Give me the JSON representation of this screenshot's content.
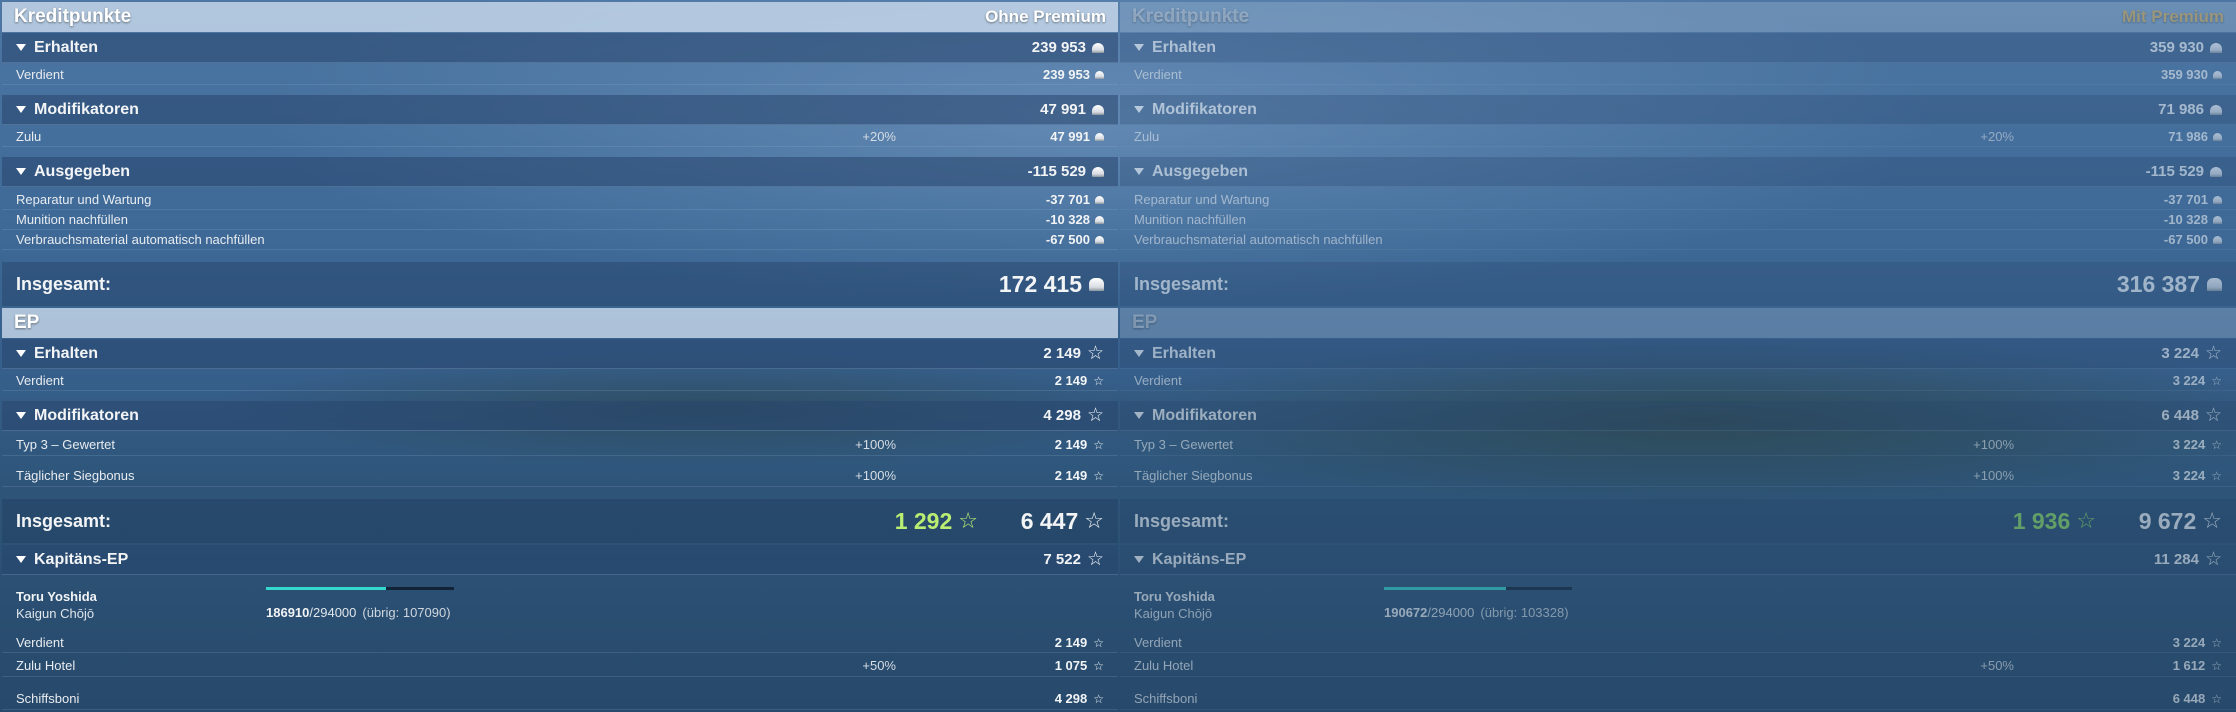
{
  "columns": [
    {
      "id": "standard",
      "title": "Kreditpunkte",
      "premium_label": "Ohne Premium",
      "credits": {
        "received": {
          "label": "Erhalten",
          "value": "239 953",
          "items": [
            {
              "label": "Verdient",
              "value": "239 953"
            }
          ]
        },
        "modifiers": {
          "label": "Modifikatoren",
          "value": "47 991",
          "items": [
            {
              "label": "Zulu",
              "mod": "+20%",
              "value": "47 991"
            }
          ]
        },
        "spent": {
          "label": "Ausgegeben",
          "value": "-115 529",
          "items": [
            {
              "label": "Reparatur und Wartung",
              "value": "-37 701"
            },
            {
              "label": "Munition nachfüllen",
              "value": "-10 328"
            },
            {
              "label": "Verbrauchsmaterial automatisch nachfüllen",
              "value": "-67 500"
            }
          ]
        },
        "total": {
          "label": "Insgesamt:",
          "value": "172 415"
        }
      },
      "ep": {
        "title": "EP",
        "received": {
          "label": "Erhalten",
          "value": "2 149",
          "items": [
            {
              "label": "Verdient",
              "value": "2 149"
            }
          ]
        },
        "modifiers": {
          "label": "Modifikatoren",
          "value": "4 298",
          "items": [
            {
              "label": "Typ 3 – Gewertet",
              "mod": "+100%",
              "value": "2 149"
            },
            {
              "label": "Täglicher Siegbonus",
              "mod": "+100%",
              "value": "2 149"
            }
          ]
        },
        "total": {
          "label": "Insgesamt:",
          "green_value": "1 292",
          "value": "6 447"
        }
      },
      "captain": {
        "label": "Kapitäns-EP",
        "value": "7 522",
        "name": "Toru Yoshida",
        "rank": "Kaigun Chōjō",
        "xp_current": "186910",
        "xp_max": "/294000",
        "xp_rest": "(übrig: 107090)",
        "xp_progress": 0.636,
        "items": [
          {
            "label": "Verdient",
            "value": "2 149"
          },
          {
            "label": "Zulu Hotel",
            "mod": "+50%",
            "value": "1 075"
          },
          {
            "label": "Schiffsboni",
            "value": "4 298"
          }
        ]
      }
    },
    {
      "id": "premium",
      "title": "Kreditpunkte",
      "premium_label": "Mit Premium",
      "credits": {
        "received": {
          "label": "Erhalten",
          "value": "359 930",
          "items": [
            {
              "label": "Verdient",
              "value": "359 930"
            }
          ]
        },
        "modifiers": {
          "label": "Modifikatoren",
          "value": "71 986",
          "items": [
            {
              "label": "Zulu",
              "mod": "+20%",
              "value": "71 986"
            }
          ]
        },
        "spent": {
          "label": "Ausgegeben",
          "value": "-115 529",
          "items": [
            {
              "label": "Reparatur und Wartung",
              "value": "-37 701"
            },
            {
              "label": "Munition nachfüllen",
              "value": "-10 328"
            },
            {
              "label": "Verbrauchsmaterial automatisch nachfüllen",
              "value": "-67 500"
            }
          ]
        },
        "total": {
          "label": "Insgesamt:",
          "value": "316 387"
        }
      },
      "ep": {
        "title": "EP",
        "received": {
          "label": "Erhalten",
          "value": "3 224",
          "items": [
            {
              "label": "Verdient",
              "value": "3 224"
            }
          ]
        },
        "modifiers": {
          "label": "Modifikatoren",
          "value": "6 448",
          "items": [
            {
              "label": "Typ 3 – Gewertet",
              "mod": "+100%",
              "value": "3 224"
            },
            {
              "label": "Täglicher Siegbonus",
              "mod": "+100%",
              "value": "3 224"
            }
          ]
        },
        "total": {
          "label": "Insgesamt:",
          "green_value": "1 936",
          "value": "9 672"
        }
      },
      "captain": {
        "label": "Kapitäns-EP",
        "value": "11 284",
        "name": "Toru Yoshida",
        "rank": "Kaigun Chōjō",
        "xp_current": "190672",
        "xp_max": "/294000",
        "xp_rest": "(übrig: 103328)",
        "xp_progress": 0.649,
        "items": [
          {
            "label": "Verdient",
            "value": "3 224"
          },
          {
            "label": "Zulu Hotel",
            "mod": "+50%",
            "value": "1 612"
          },
          {
            "label": "Schiffsboni",
            "value": "6 448"
          }
        ]
      }
    }
  ]
}
